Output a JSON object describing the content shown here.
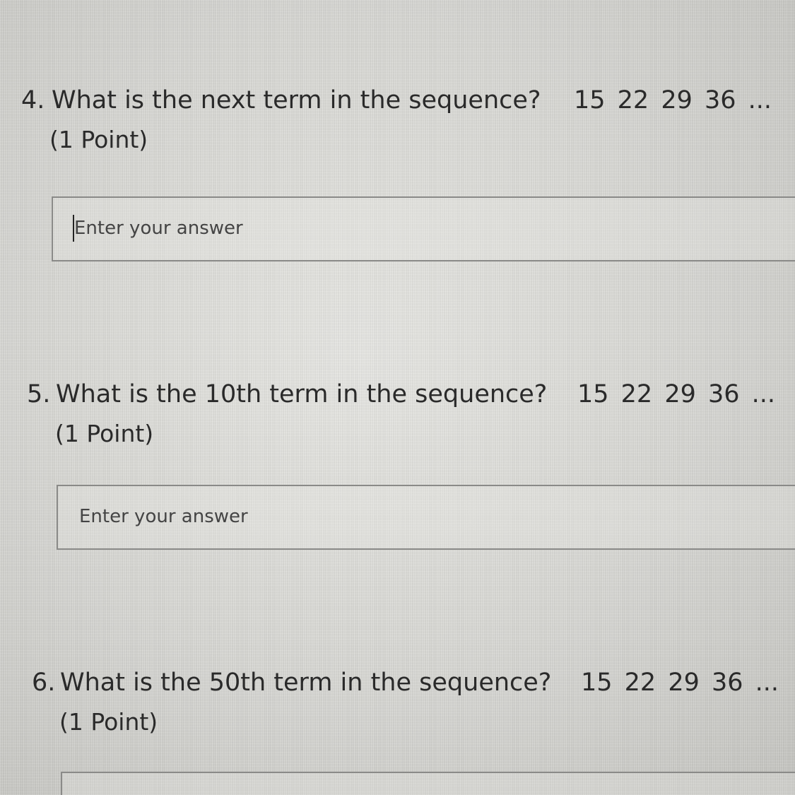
{
  "questions": [
    {
      "number": "4.",
      "text": "What is the next term in the sequence?",
      "sequence": "15 22 29 36 ...",
      "points": "(1 Point)",
      "answer_placeholder": "Enter your answer",
      "answer_value": ""
    },
    {
      "number": "5.",
      "text": "What is the 10th term in the sequence?",
      "sequence": "15 22 29 36 ...",
      "points": "(1 Point)",
      "answer_placeholder": "Enter your answer",
      "answer_value": ""
    },
    {
      "number": "6.",
      "text": "What is the 50th term in the sequence?",
      "sequence": "15 22 29 36 ...",
      "points": "(1 Point)",
      "answer_placeholder": "",
      "answer_value": ""
    }
  ]
}
